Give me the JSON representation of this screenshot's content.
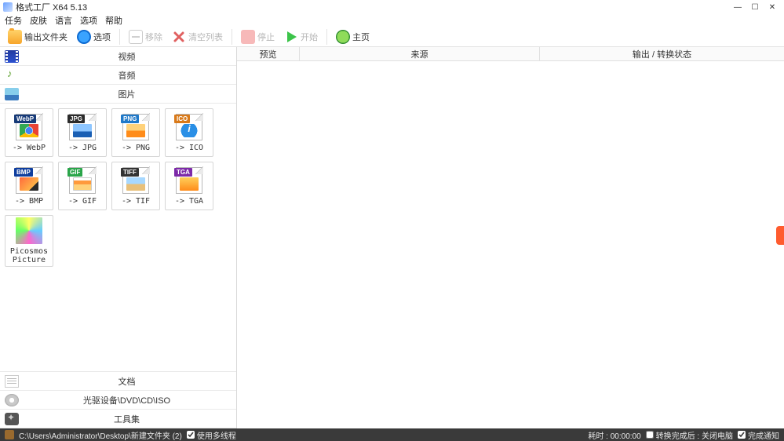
{
  "window": {
    "title": "格式工厂 X64 5.13"
  },
  "menu": [
    "任务",
    "皮肤",
    "语言",
    "选项",
    "帮助"
  ],
  "toolbar": {
    "output_folder": "输出文件夹",
    "options": "选项",
    "remove": "移除",
    "clear_list": "清空列表",
    "stop": "停止",
    "start": "开始",
    "home": "主页"
  },
  "categories": {
    "video": "视频",
    "audio": "音频",
    "image": "图片",
    "document": "文档",
    "disc": "光驱设备\\DVD\\CD\\ISO",
    "toolbox": "工具集"
  },
  "formats": [
    {
      "badge": "WebP",
      "badge_cls": "b-webp",
      "thumb": "th-chrome",
      "label": "-> WebP"
    },
    {
      "badge": "JPG",
      "badge_cls": "b-jpg",
      "thumb": "th-photo",
      "label": "-> JPG"
    },
    {
      "badge": "PNG",
      "badge_cls": "b-png",
      "thumb": "th-png",
      "label": "-> PNG"
    },
    {
      "badge": "ICO",
      "badge_cls": "b-ico",
      "thumb": "th-info",
      "label": "-> ICO"
    },
    {
      "badge": "BMP",
      "badge_cls": "b-bmp",
      "thumb": "th-bmp",
      "label": "-> BMP"
    },
    {
      "badge": "GIF",
      "badge_cls": "b-gif",
      "thumb": "th-gif",
      "label": "-> GIF"
    },
    {
      "badge": "TIFF",
      "badge_cls": "b-tiff",
      "thumb": "th-tif",
      "label": "-> TIF"
    },
    {
      "badge": "TGA",
      "badge_cls": "b-tga",
      "thumb": "th-tga",
      "label": "-> TGA"
    },
    {
      "badge": "",
      "badge_cls": "",
      "thumb": "th-picosmos",
      "label": "Picosmos\nPicture"
    }
  ],
  "columns": {
    "preview": "预览",
    "source": "来源",
    "output": "输出 / 转换状态"
  },
  "status": {
    "path": "C:\\Users\\Administrator\\Desktop\\新建文件夹 (2)",
    "multithread": "使用多线程",
    "elapsed": "耗时 : 00:00:00",
    "shutdown": "转换完成后 : 关闭电脑",
    "notify": "完成通知"
  }
}
